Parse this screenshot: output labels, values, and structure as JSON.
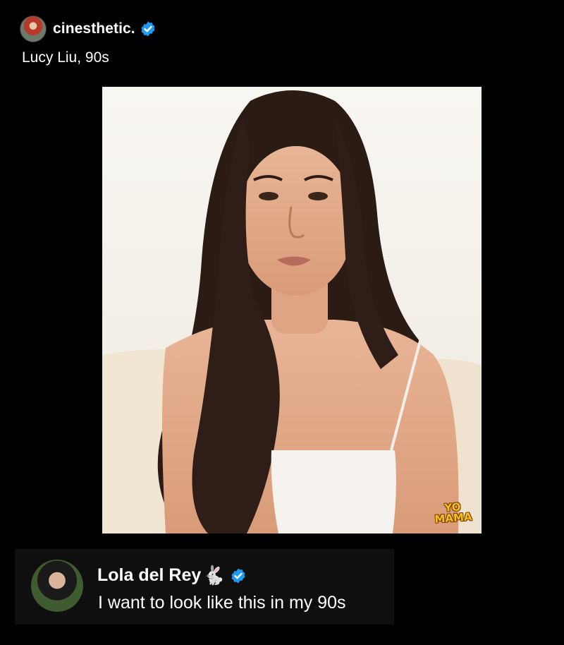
{
  "post": {
    "username": "cinesthetic.",
    "caption": "Lucy Liu, 90s",
    "verified": true
  },
  "photo": {
    "watermark_line1": "YO",
    "watermark_line2": "MAMA"
  },
  "reply": {
    "name": "Lola del Rey",
    "emoji": "🐇",
    "verified": true,
    "text": "I want to look like this in my 90s"
  },
  "colors": {
    "background": "#000000",
    "verified_badge": "#1d9bf0",
    "watermark": "#f4c21a"
  }
}
